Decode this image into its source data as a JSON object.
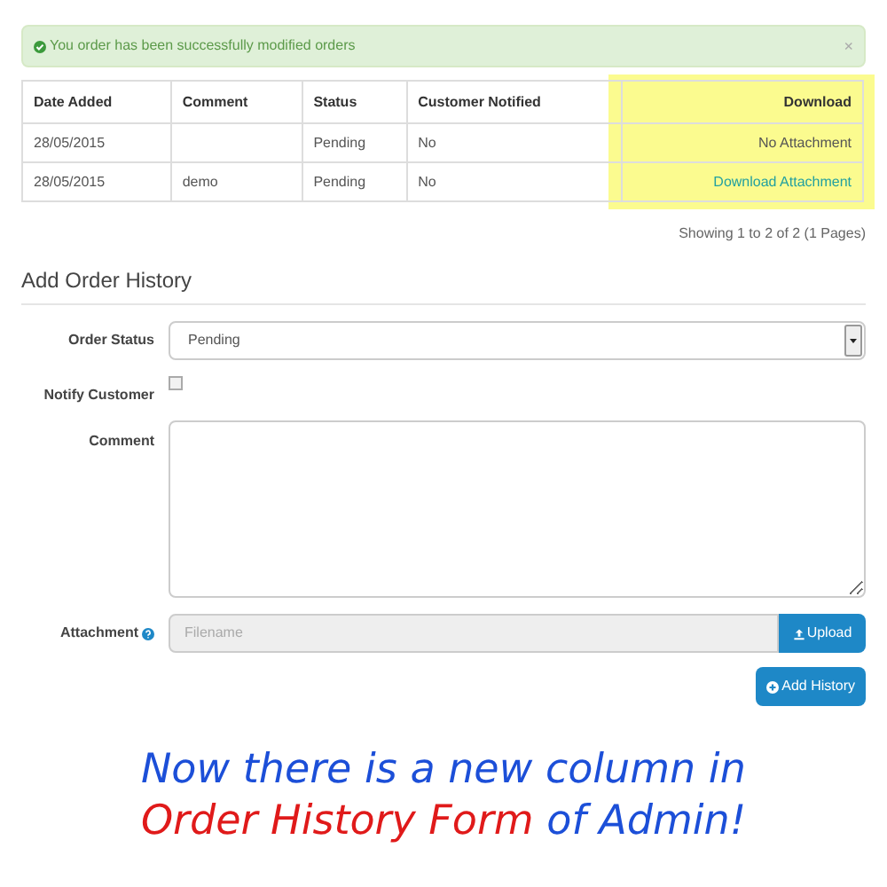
{
  "alert": {
    "message": "You order has been successfully modified orders",
    "close": "×"
  },
  "history_table": {
    "columns": [
      {
        "label": "Date Added",
        "highlighted": false
      },
      {
        "label": "Comment",
        "highlighted": false
      },
      {
        "label": "Status",
        "highlighted": false
      },
      {
        "label": "Customer Notified",
        "highlighted": false
      },
      {
        "label": "Download",
        "highlighted": true
      }
    ],
    "rows": [
      {
        "cells": [
          "28/05/2015",
          "",
          "Pending",
          "No",
          "No Attachment"
        ],
        "kind": "text"
      },
      {
        "cells": [
          "28/05/2015",
          "demo",
          "Pending",
          "No",
          "Download Attachment"
        ],
        "kind": "link"
      }
    ]
  },
  "pagination": "Showing 1 to 2 of 2 (1 Pages)",
  "form": {
    "title": "Add Order History",
    "order_status": {
      "label": "Order Status",
      "value": "Pending"
    },
    "notify": {
      "label": "Notify Customer",
      "checked": false
    },
    "comment": {
      "label": "Comment"
    },
    "attachment": {
      "label": "Attachment",
      "placeholder": "Filename",
      "button": "Upload"
    },
    "submit": "Add History"
  },
  "caption": {
    "lines": [
      [
        {
          "text": "Now there is a new column in",
          "color": "#1c4fd8"
        }
      ],
      [
        {
          "text": "Order History Form",
          "color": "#e01a1a"
        },
        {
          "text": " of Admin!",
          "color": "#1c4fd8"
        }
      ]
    ]
  }
}
